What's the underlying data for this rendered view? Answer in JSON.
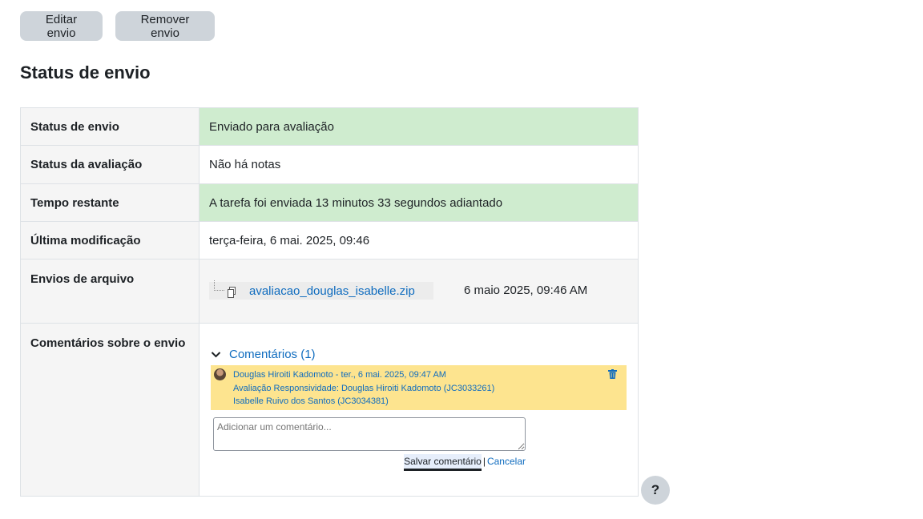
{
  "toolbar": {
    "edit_label": "Editar envio",
    "remove_label": "Remover envio"
  },
  "page": {
    "title": "Status de envio"
  },
  "status_table": {
    "submission_status": {
      "label": "Status de envio",
      "value": "Enviado para avaliação"
    },
    "grading_status": {
      "label": "Status da avaliação",
      "value": "Não há notas"
    },
    "time_remaining": {
      "label": "Tempo restante",
      "value": "A tarefa foi enviada 13 minutos 33 segundos adiantado"
    },
    "last_modified": {
      "label": "Última modificação",
      "value": "terça-feira, 6 mai. 2025, 09:46"
    },
    "file_submissions": {
      "label": "Envios de arquivo",
      "file_name": "avaliacao_douglas_isabelle.zip",
      "file_date": "6 maio 2025, 09:46 AM"
    },
    "comments": {
      "label": "Comentários sobre o envio",
      "toggle_label": "Comentários (1)",
      "entry": {
        "header": "Douglas Hiroiti Kadomoto - ter., 6 mai. 2025, 09:47 AM",
        "line1": "Avaliação Responsividade: Douglas Hiroiti Kadomoto (JC3033261)",
        "line2": "Isabelle Ruivo dos Santos (JC3034381)"
      },
      "input_placeholder": "Adicionar um comentário...",
      "save_label": "Salvar comentário",
      "separator": "|",
      "cancel_label": "Cancelar"
    }
  },
  "help": {
    "label": "?"
  },
  "colors": {
    "success_bg": "#cfeccf",
    "comment_bg": "#fde48f",
    "link": "#0f6cbf",
    "button_bg": "#ced4da"
  },
  "icons": {
    "file": "file-icon",
    "chevron": "chevron-down-icon",
    "delete": "trash-icon",
    "avatar": "avatar"
  }
}
